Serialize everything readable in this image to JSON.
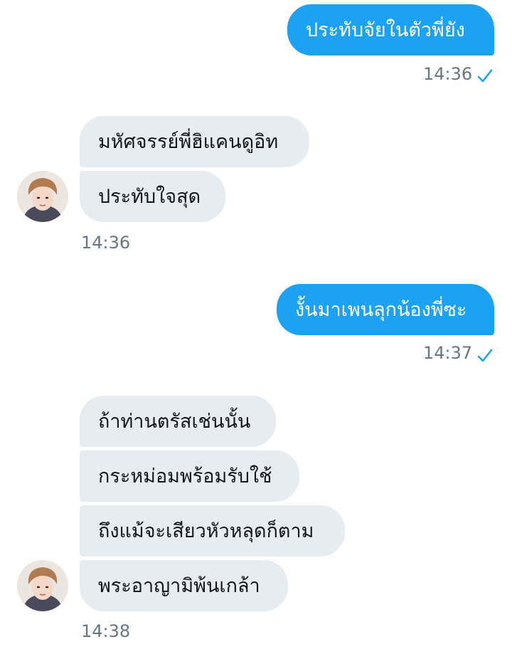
{
  "conversation": {
    "messages": [
      {
        "side": "sent",
        "text": "ประทับจัยในตัวพี่ยัง"
      },
      {
        "side": "received",
        "text": "มหัศจรรย์พี่ฮิแคนดูอิท"
      },
      {
        "side": "received",
        "text": "ประทับใจสุด"
      },
      {
        "side": "sent",
        "text": "งั้นมาเพนลุกน้องพี่ซะ"
      },
      {
        "side": "received",
        "text": "ถ้าท่านตรัสเช่นนั้น"
      },
      {
        "side": "received",
        "text": "กระหม่อมพร้อมรับใช้"
      },
      {
        "side": "received",
        "text": "ถึงแม้จะเสียวหัวหลุดก็ตาม"
      },
      {
        "side": "received",
        "text": "พระอาญามิพ้นเกล้า"
      }
    ],
    "timestamps": {
      "sent_1": "14:36",
      "received_1": "14:36",
      "sent_2": "14:37",
      "received_2": "14:38"
    }
  },
  "colors": {
    "sent_bubble": "#1da1f2",
    "received_bubble": "#e6ecf0",
    "timestamp_text": "#657786",
    "read_check": "#1da1f2"
  },
  "icons": {
    "read_receipt": "check-icon",
    "avatar": "user-avatar"
  }
}
